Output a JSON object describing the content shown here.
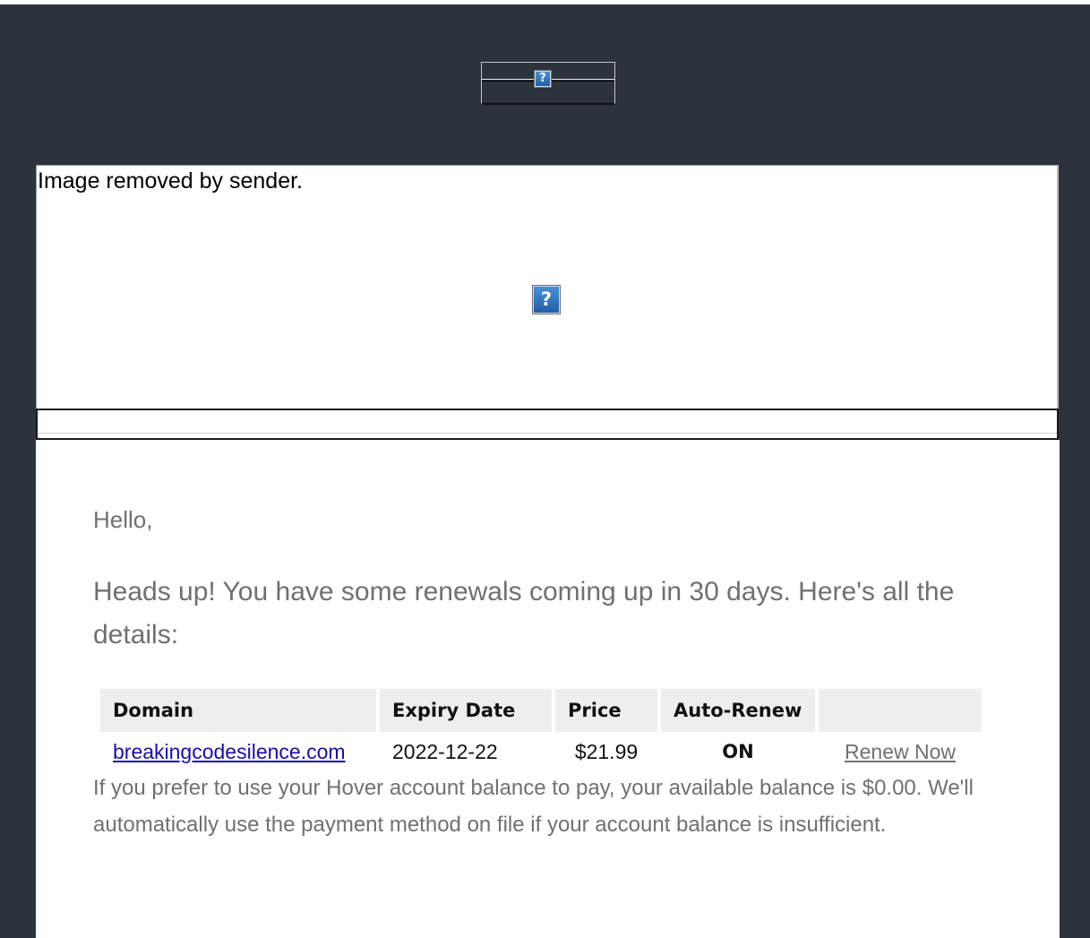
{
  "header_image": {
    "icon": "question-mark-icon",
    "glyph": "?"
  },
  "banner": {
    "alt_text": "Image removed by sender.",
    "icon": "question-mark-icon",
    "glyph": "?"
  },
  "email": {
    "greeting": "Hello,",
    "intro": "Heads up! You have some renewals coming up in 30 days. Here's all the details:",
    "table": {
      "headers": [
        "Domain",
        "Expiry Date",
        "Price",
        "Auto-Renew",
        ""
      ],
      "rows": [
        {
          "domain": "breakingcodesilence.com",
          "expiry": "2022-12-22",
          "price": "$21.99",
          "auto_renew": "ON",
          "action": "Renew Now"
        }
      ]
    },
    "balance_note": "If you prefer to use your Hover account balance to pay, your available balance is $0.00. We'll automatically use the payment method on file if your account balance is insufficient."
  },
  "colors": {
    "frame_background": "#2d333d",
    "body_text": "#707070",
    "link": "#1a0dab",
    "table_header_bg": "#eeeeee"
  }
}
